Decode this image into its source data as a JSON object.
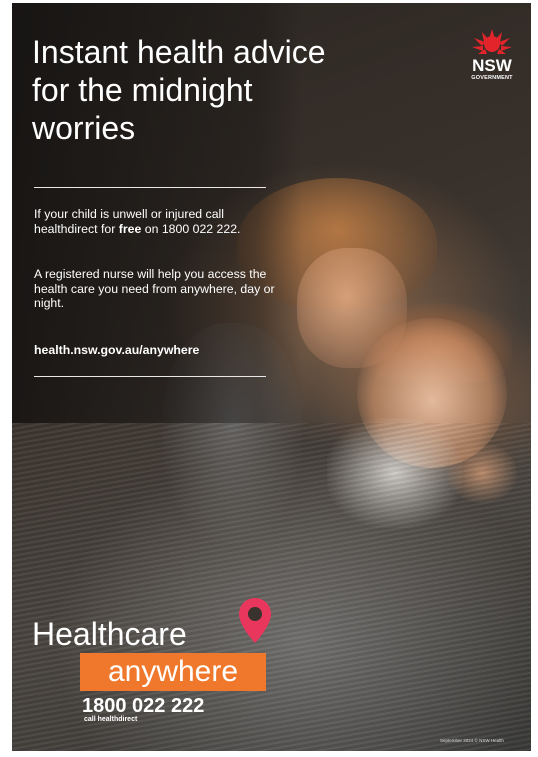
{
  "headline": "Instant health advice for the midnight worries",
  "paragraph_1": {
    "before": "If your child is unwell or injured call healthdirect for ",
    "bold": "free",
    "after": " on 1800 022 222."
  },
  "paragraph_2": "A registered nurse will help you access the health care you need from anywhere, day or night.",
  "website": "health.nsw.gov.au/anywhere",
  "logo": {
    "word": "NSW",
    "sub": "GOVERNMENT",
    "icon": "waratah-icon",
    "color": "#e3242b"
  },
  "brand": {
    "line1": "Healthcare",
    "line2": "anywhere",
    "accent_color": "#f0782d",
    "pin_icon": "location-pin-icon",
    "pin_color": "#e8365d"
  },
  "phone": {
    "number": "1800 022 222",
    "caption": "call healthdirect"
  },
  "footnote": "September 2024 © NSW Health"
}
